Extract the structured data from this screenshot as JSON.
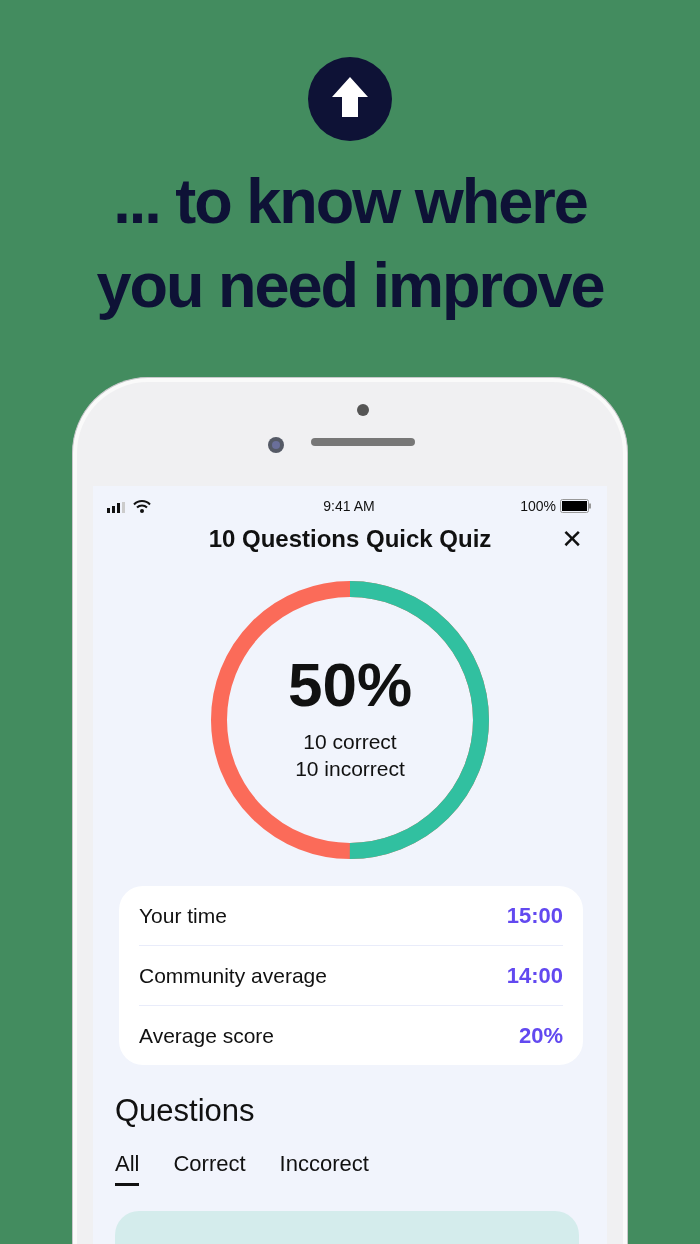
{
  "headline": "... to know where you need improve",
  "status_bar": {
    "time": "9:41 AM",
    "battery": "100%"
  },
  "quiz": {
    "title": "10 Questions Quick Quiz",
    "close": "✕"
  },
  "result": {
    "percent": "50%",
    "correct": "10 correct",
    "incorrect": "10 incorrect",
    "level": 0.5
  },
  "stats": [
    {
      "label": "Your time",
      "value": "15:00"
    },
    {
      "label": "Community average",
      "value": "14:00"
    },
    {
      "label": "Average score",
      "value": "20%"
    }
  ],
  "questions": {
    "heading": "Questions",
    "tabs": [
      {
        "label": "All",
        "selected": true
      },
      {
        "label": "Correct",
        "selected": false
      },
      {
        "label": "Inccorect",
        "selected": false
      }
    ]
  }
}
